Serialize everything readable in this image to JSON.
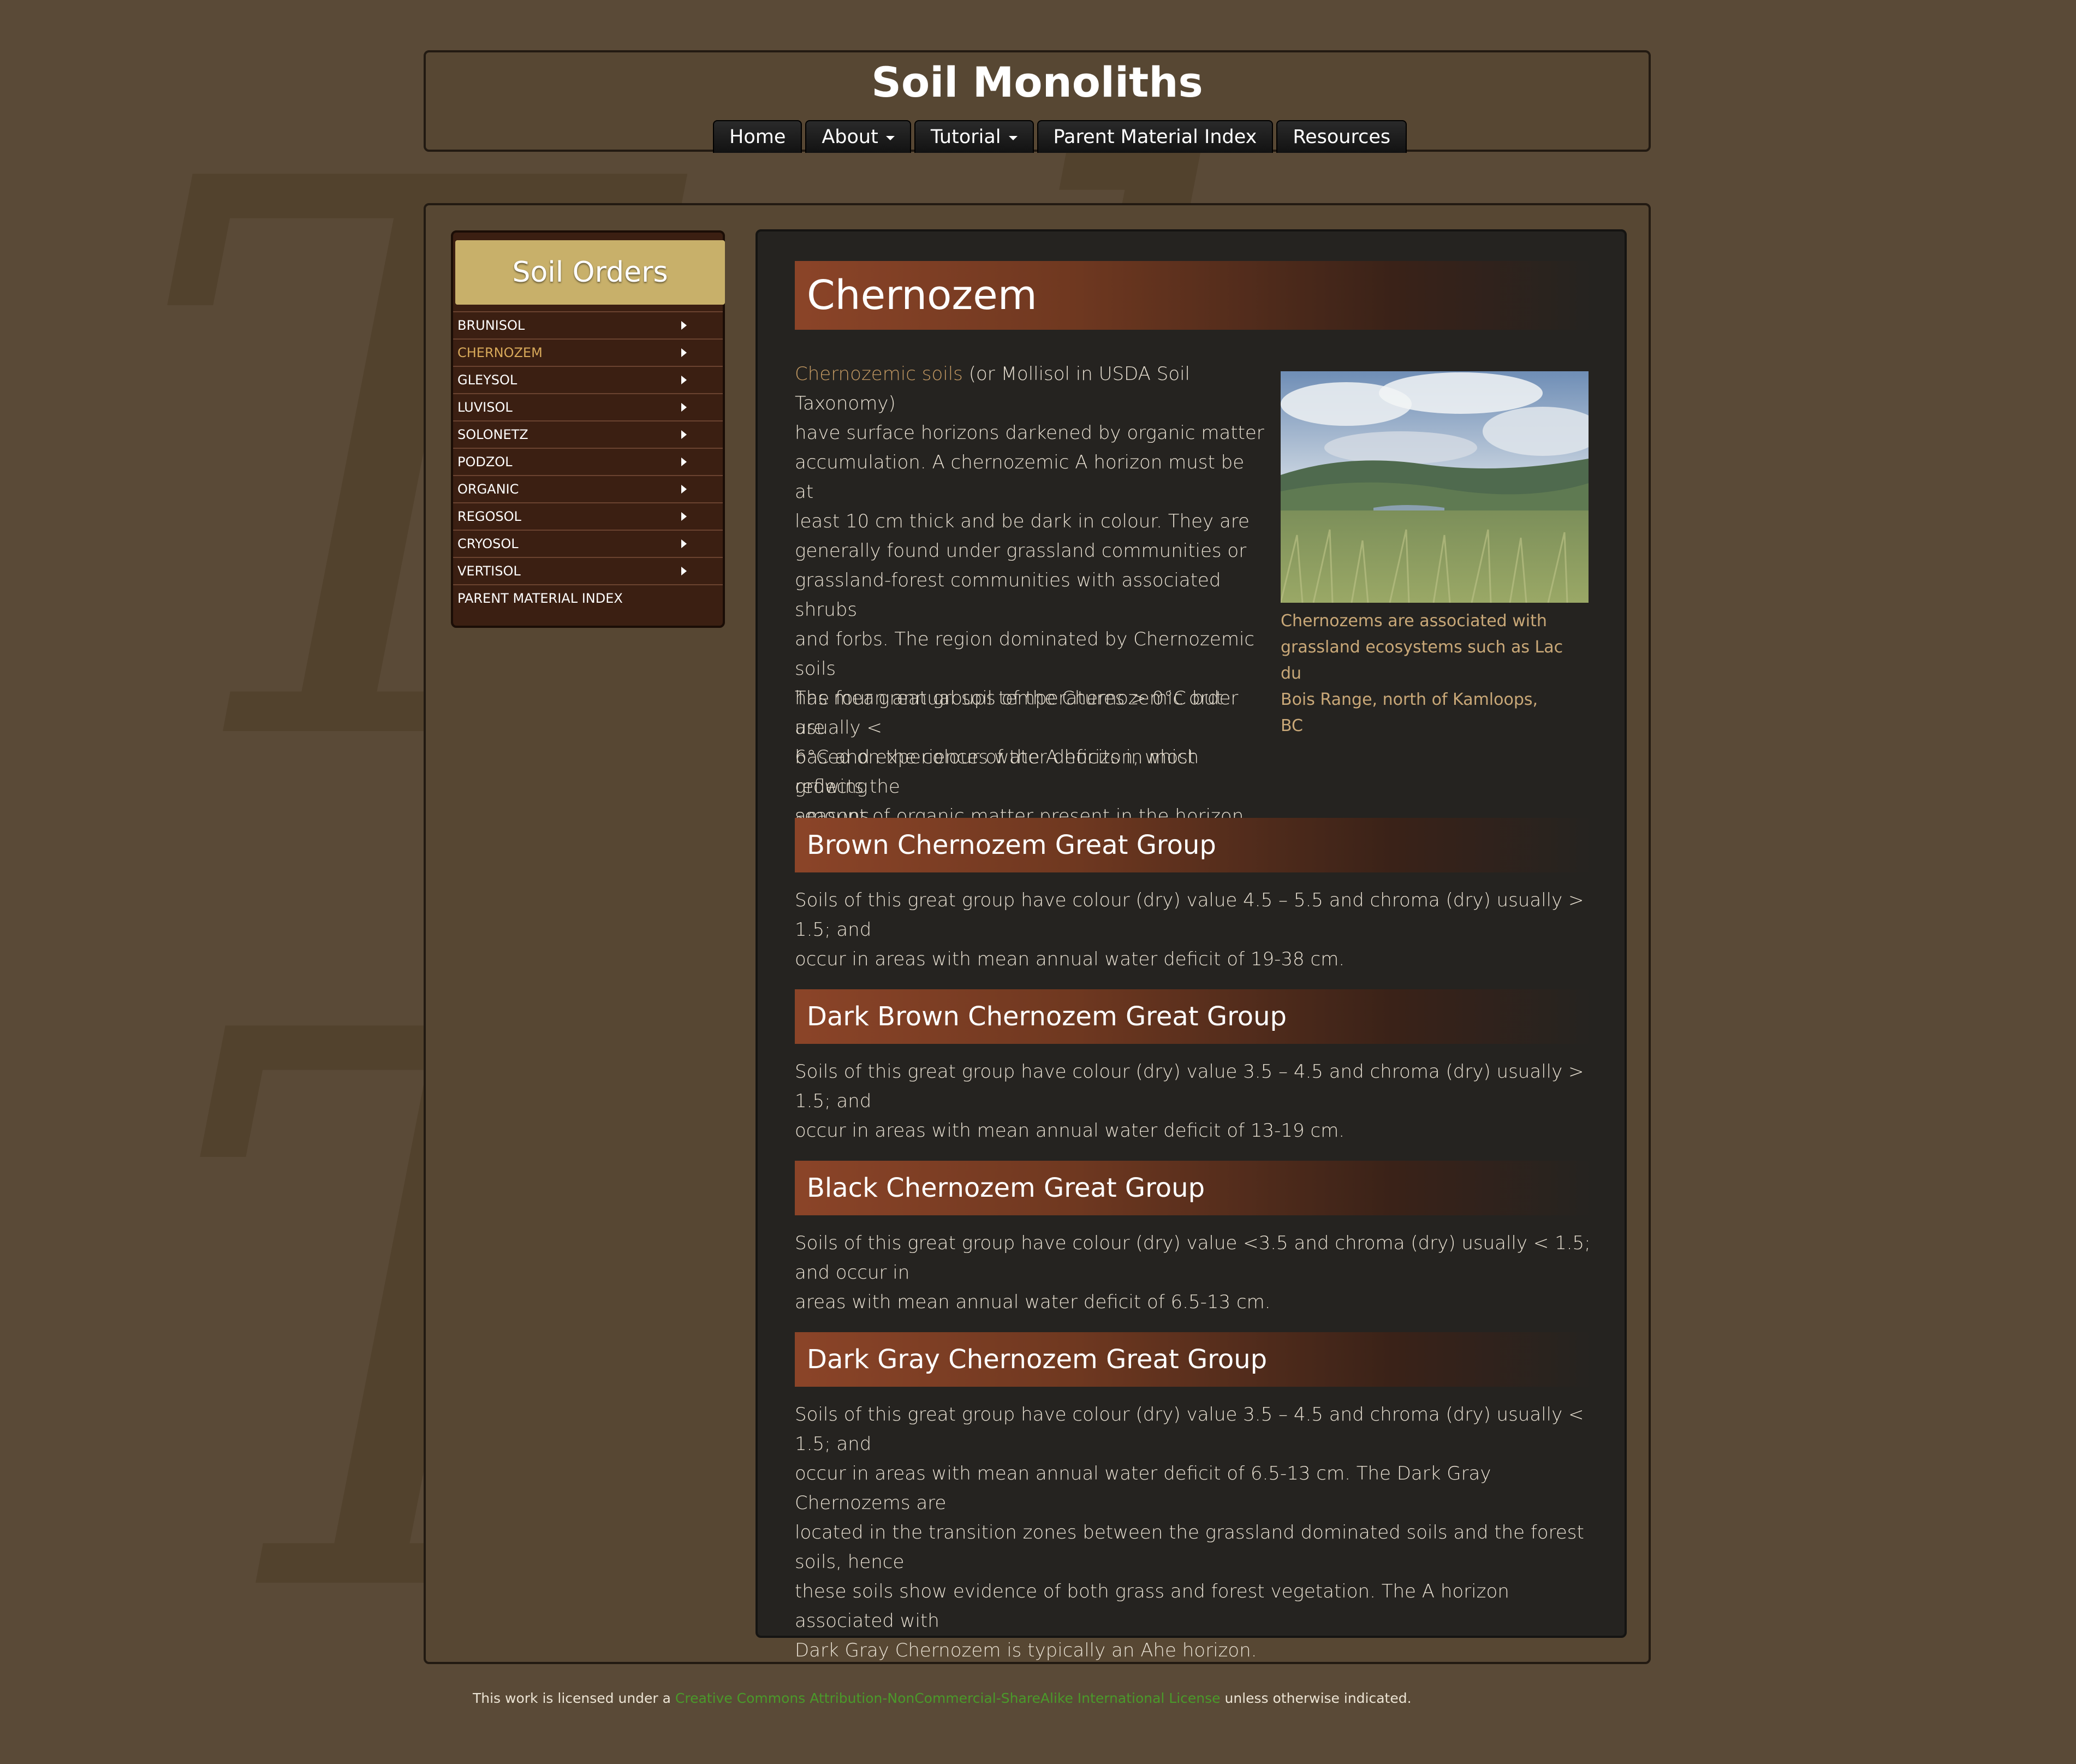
{
  "header": {
    "title": "Soil Monoliths",
    "nav": [
      {
        "label": "Home",
        "dropdown": false
      },
      {
        "label": "About",
        "dropdown": true
      },
      {
        "label": "Tutorial",
        "dropdown": true
      },
      {
        "label": "Parent Material Index",
        "dropdown": false
      },
      {
        "label": "Resources",
        "dropdown": false
      }
    ]
  },
  "sidebar": {
    "title": "Soil Orders",
    "items": [
      {
        "label": "BRUNISOL"
      },
      {
        "label": "CHERNOZEM"
      },
      {
        "label": "GLEYSOL"
      },
      {
        "label": "LUVISOL"
      },
      {
        "label": "SOLONETZ"
      },
      {
        "label": "PODZOL"
      },
      {
        "label": "ORGANIC"
      },
      {
        "label": "REGOSOL"
      },
      {
        "label": "CRYOSOL"
      },
      {
        "label": "VERTISOL"
      },
      {
        "label": "PARENT MATERIAL INDEX"
      }
    ]
  },
  "content": {
    "title": "Chernozem",
    "intro_link": "Chernozemic soils",
    "intro_lines": [
      " (or Mollisol in USDA Soil Taxonomy)",
      "have surface horizons darkened by organic matter",
      "accumulation.  A chernozemic A horizon must be at",
      "least 10 cm thick and be dark in colour.  They are",
      "generally found under grassland communities or",
      "grassland-forest communities with associated shrubs",
      "and forbs. The region dominated by Chernozemic soils",
      "has mean annual soil temperatures > 0°C but usually <",
      "6°C and experiences water deficits in most growing",
      "seasons."
    ],
    "para2_lines": [
      "The four great groups of the Chernozemic order are",
      "based on the colour of the A horizon, which reflects the",
      "amount of organic matter present in the horizon."
    ],
    "photo_caption_lines": [
      "Chernozems are associated with",
      "grassland ecosystems such as Lac du",
      "Bois Range, north of Kamloops, BC"
    ],
    "groups": [
      {
        "title": "Brown Chernozem Great Group",
        "lines": [
          "Soils of this great group have colour (dry) value 4.5 – 5.5 and chroma (dry) usually > 1.5; and",
          "occur in areas with mean annual water deficit of 19-38 cm."
        ]
      },
      {
        "title": "Dark Brown Chernozem Great Group",
        "lines": [
          "Soils of this great group have colour (dry) value 3.5 – 4.5 and chroma (dry) usually > 1.5; and",
          "occur in areas with mean annual water deficit of 13-19 cm."
        ]
      },
      {
        "title": "Black Chernozem Great Group",
        "lines": [
          "Soils of this great group have colour (dry) value <3.5 and chroma (dry) usually < 1.5; and occur in",
          "areas with mean annual water deficit of 6.5-13 cm."
        ]
      },
      {
        "title": "Dark Gray Chernozem Great Group",
        "lines": [
          "Soils of this great group have colour (dry) value 3.5 – 4.5 and chroma (dry) usually < 1.5; and",
          "occur in areas with mean annual water deficit of 6.5-13 cm. The Dark Gray Chernozems are",
          "located in the transition zones between the grassland dominated soils and the forest soils, hence",
          "these soils show evidence of both grass and forest vegetation. The A horizon associated with",
          "Dark Gray Chernozem is typically an Ahe horizon."
        ]
      }
    ]
  },
  "footer": {
    "prefix": "This work is licensed under a ",
    "license_link": "Creative Commons Attribution-NonCommercial-ShareAlike International License",
    "suffix": " unless otherwise indicated."
  },
  "colors": {
    "background": "#5a4a37",
    "link_tan": "#c49a63",
    "active_item": "#d8a95a",
    "banner": "#8b4428",
    "sidebar_title_bg": "#c8b06a",
    "license_link": "#4a9a2a"
  }
}
